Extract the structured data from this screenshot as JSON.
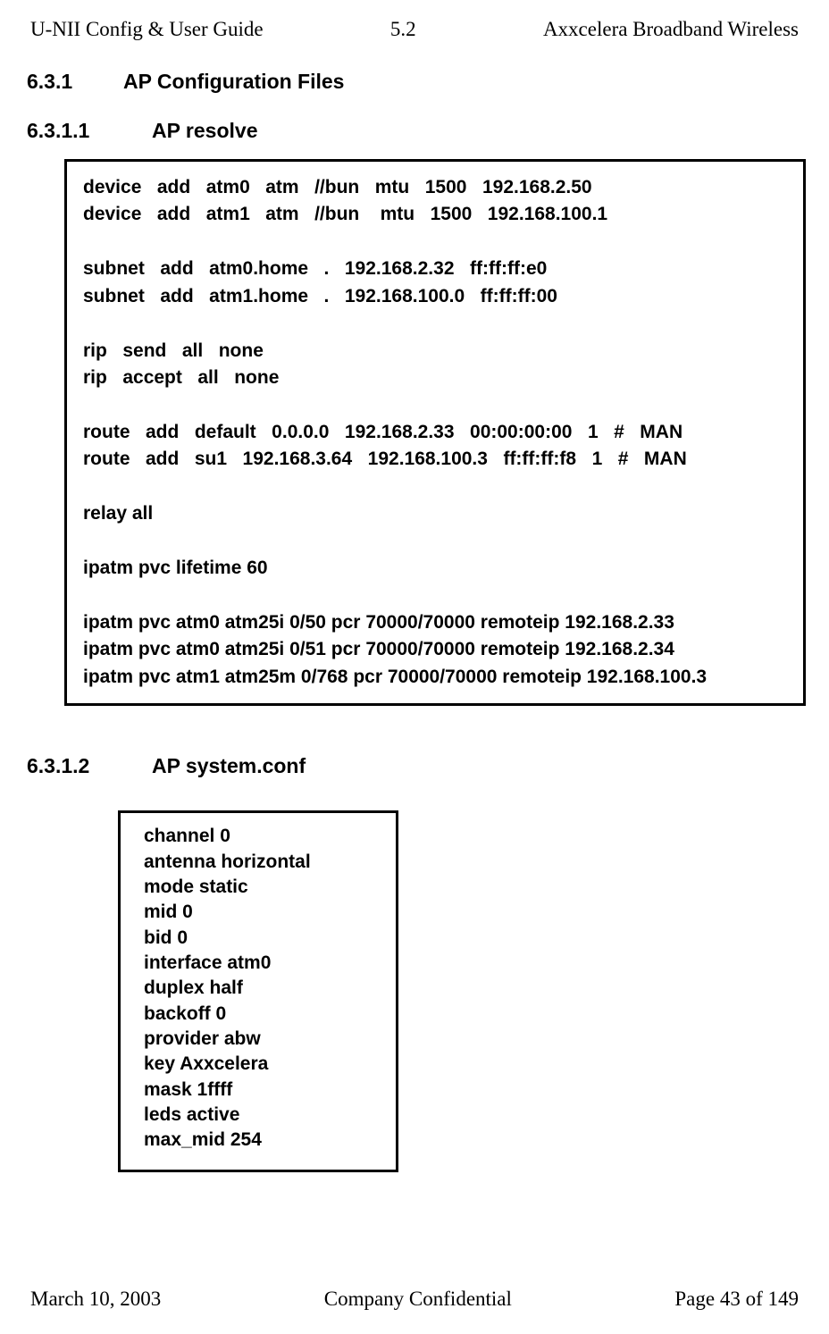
{
  "header": {
    "left": "U-NII Config & User Guide",
    "center": "5.2",
    "right": "Axxcelera Broadband Wireless"
  },
  "sections": {
    "s631_num": "6.3.1",
    "s631_title": "AP Configuration Files",
    "s6311_num": "6.3.1.1",
    "s6311_title": "AP resolve",
    "s6312_num": "6.3.1.2",
    "s6312_title": "AP system.conf"
  },
  "code_resolve": "device   add   atm0   atm   //bun   mtu   1500   192.168.2.50\ndevice   add   atm1   atm   //bun    mtu   1500   192.168.100.1\n\nsubnet   add   atm0.home   .   192.168.2.32   ff:ff:ff:e0\nsubnet   add   atm1.home   .   192.168.100.0   ff:ff:ff:00\n\nrip   send   all   none\nrip   accept   all   none\n\nroute   add   default   0.0.0.0   192.168.2.33   00:00:00:00   1   #   MAN\nroute   add   su1   192.168.3.64   192.168.100.3   ff:ff:ff:f8   1   #   MAN\n\nrelay all\n\nipatm pvc lifetime 60\n\nipatm pvc atm0 atm25i 0/50 pcr 70000/70000 remoteip 192.168.2.33\nipatm pvc atm0 atm25i 0/51 pcr 70000/70000 remoteip 192.168.2.34\nipatm pvc atm1 atm25m 0/768 pcr 70000/70000 remoteip 192.168.100.3",
  "code_systemconf": "channel 0\nantenna horizontal\nmode static\nmid 0\nbid 0\ninterface atm0\nduplex half\nbackoff 0\nprovider abw\nkey Axxcelera\nmask 1ffff\nleds active\nmax_mid 254",
  "footer": {
    "left": "March 10, 2003",
    "center": "Company Confidential",
    "right": "Page 43 of 149"
  }
}
